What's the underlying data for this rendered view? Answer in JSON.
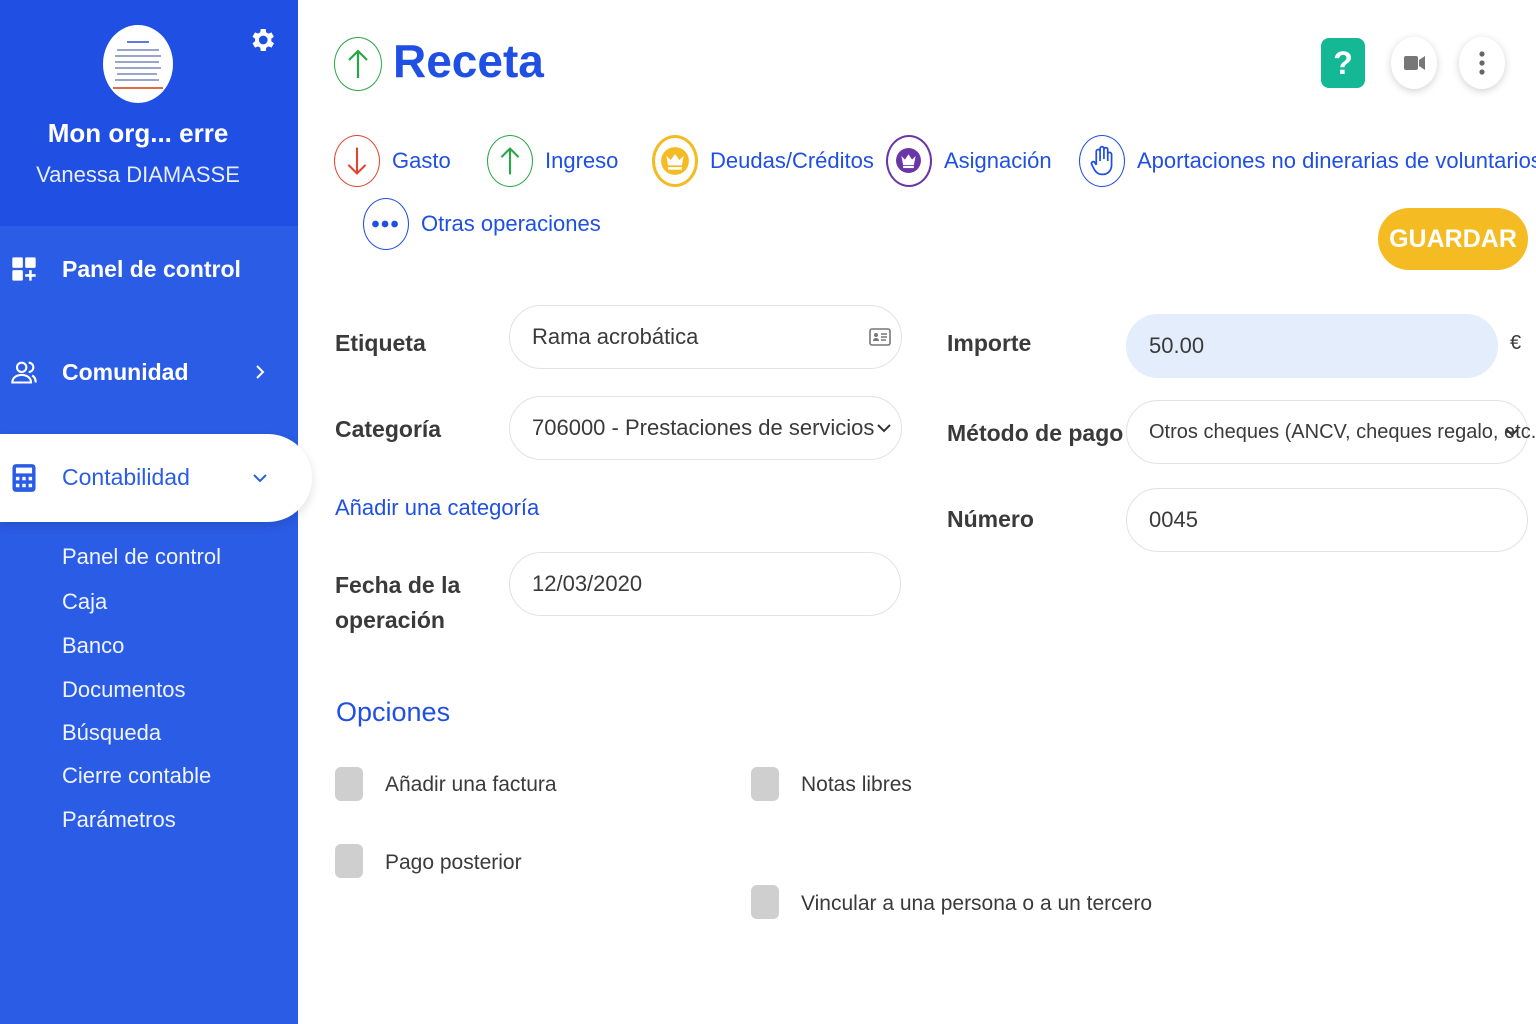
{
  "colors": {
    "sidebar": "#2b5ce6",
    "profile": "#1f4fe3",
    "accent": "#1f4fe3",
    "income": "#28a745",
    "expense": "#e0462e",
    "debts": "#f4bb22",
    "allocation": "#6a35a8",
    "help": "#15b895",
    "save": "#f4bb22"
  },
  "sidebar": {
    "org_name": "Mon org... erre",
    "user_name": "Vanessa DIAMASSE",
    "settings_icon": "gear-icon",
    "nav": [
      {
        "label": "Panel de control",
        "icon": "dashboard-icon"
      },
      {
        "label": "Comunidad",
        "icon": "people-icon"
      },
      {
        "label": "Contabilidad",
        "icon": "calculator-icon",
        "active": true
      }
    ],
    "submenu": [
      "Panel de control",
      "Caja",
      "Banco",
      "Documentos",
      "Búsqueda",
      "Cierre contable",
      "Parámetros"
    ]
  },
  "header": {
    "title": "Receta",
    "help_label": "?",
    "title_icon": "arrow-up-icon"
  },
  "operations": [
    {
      "label": "Gasto",
      "icon": "arrow-down-icon"
    },
    {
      "label": "Ingreso",
      "icon": "arrow-up-icon"
    },
    {
      "label": "Deudas/Créditos",
      "icon": "crown-icon"
    },
    {
      "label": "Asignación",
      "icon": "crown-arrows-icon"
    },
    {
      "label": "Aportaciones no dinerarias de voluntarios",
      "icon": "hand-icon"
    },
    {
      "label": "Otras operaciones",
      "icon": "dots-icon"
    }
  ],
  "save_label": "GUARDAR",
  "form": {
    "etiqueta": {
      "label": "Etiqueta",
      "value": "Rama acrobática"
    },
    "categoria": {
      "label": "Categoría",
      "value": "706000 - Prestaciones de servicios"
    },
    "add_category": "Añadir una categoría",
    "fecha": {
      "label_line1": "Fecha de la",
      "label_line2": "operación",
      "value": "12/03/2020"
    },
    "importe": {
      "label": "Importe",
      "value": "50.00",
      "currency": "€"
    },
    "metodo": {
      "label": "Método de pago",
      "value": "Otros cheques (ANCV, cheques regalo, etc.)"
    },
    "numero": {
      "label": "Número",
      "value": "0045"
    }
  },
  "options": {
    "title": "Opciones",
    "items": [
      "Añadir una factura",
      "Notas libres",
      "Pago posterior",
      "Vincular a una persona o a un tercero"
    ]
  }
}
